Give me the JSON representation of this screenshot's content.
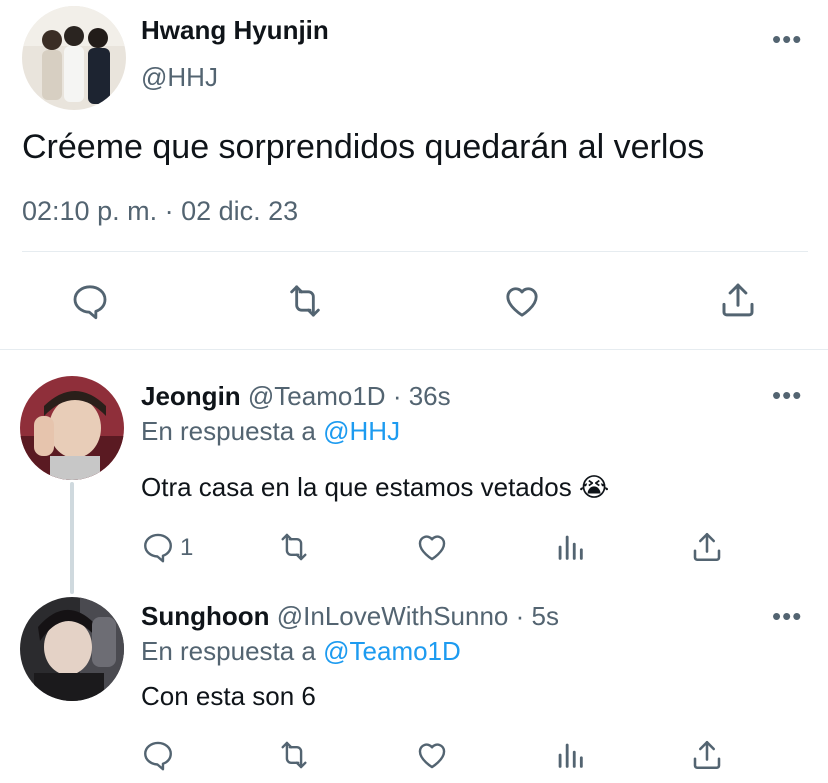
{
  "main_tweet": {
    "author_name": "Hwang Hyunjin",
    "author_handle": "@HHJ",
    "text": "Créeme que sorprendidos quedarán al verlos",
    "timestamp": "02:10 p. m. · 02 dic. 23",
    "more_label": "•••",
    "actions": [
      "reply-icon",
      "retweet-icon",
      "like-icon",
      "share-icon"
    ]
  },
  "replies": [
    {
      "author_name": "Jeongin",
      "author_handle": "@Teamo1D",
      "age": "· 36s",
      "reply_prefix": "En respuesta a",
      "reply_to": "@HHJ",
      "text": "Otra casa en la que estamos vetados 😭",
      "reply_count": "1",
      "more_label": "•••"
    },
    {
      "author_name": "Sunghoon",
      "author_handle": "@InLoveWithSunno",
      "age": "· 5s",
      "reply_prefix": "En respuesta a",
      "reply_to": "@Teamo1D",
      "text": "Con esta son 6",
      "reply_count": "",
      "more_label": "•••"
    }
  ],
  "colors": {
    "text": "#0f1419",
    "secondary": "#536471",
    "link": "#1d9bf0",
    "divider": "#e6ecf0"
  }
}
